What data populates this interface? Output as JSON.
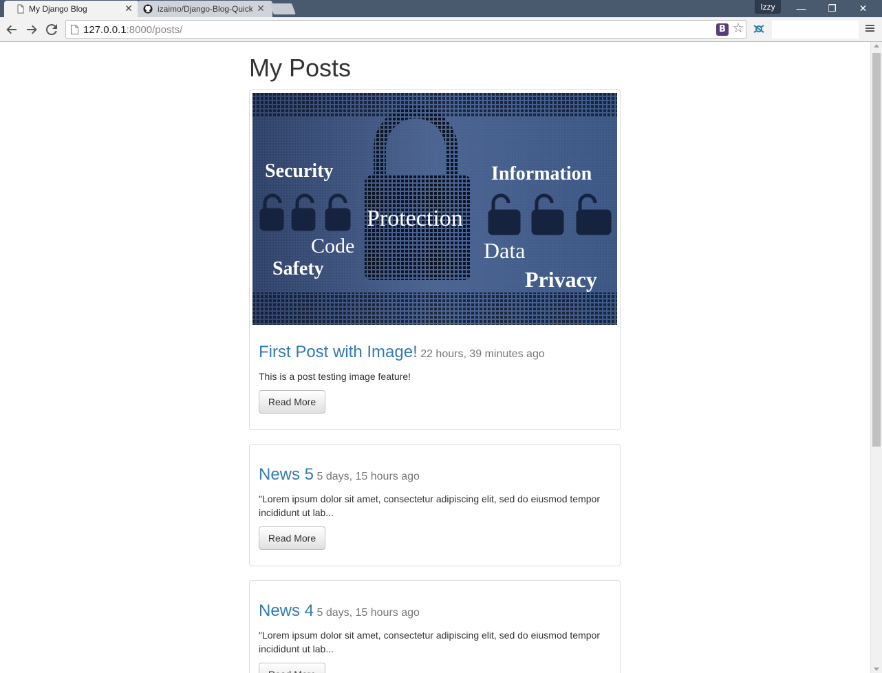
{
  "browser": {
    "tabs": [
      {
        "title": "My Django Blog",
        "active": true
      },
      {
        "title": "izaimo/Django-Blog-Quick",
        "active": false
      }
    ],
    "profile_name": "Izzy",
    "url_host": "127.0.0.1",
    "url_rest": ":8000/posts/",
    "extension_letter": "B"
  },
  "page": {
    "title": "My Posts",
    "read_more_label": "Read More",
    "image_words": {
      "security": "Security",
      "information": "Information",
      "protection": "Protection",
      "code": "Code",
      "data": "Data",
      "safety": "Safety",
      "privacy": "Privacy"
    },
    "posts": [
      {
        "title": "First Post with Image!",
        "time": "22 hours, 39 minutes ago",
        "excerpt": "This is a post testing image feature!"
      },
      {
        "title": "News 5",
        "time": "5 days, 15 hours ago",
        "excerpt": "\"Lorem ipsum dolor sit amet, consectetur adipiscing elit, sed do eiusmod tempor incididunt ut lab..."
      },
      {
        "title": "News 4",
        "time": "5 days, 15 hours ago",
        "excerpt": "\"Lorem ipsum dolor sit amet, consectetur adipiscing elit, sed do eiusmod tempor incididunt ut lab..."
      }
    ]
  },
  "colors": {
    "link": "#337ab7",
    "tabstrip": "#4a5a6e",
    "image_bg": "#3d5278"
  }
}
